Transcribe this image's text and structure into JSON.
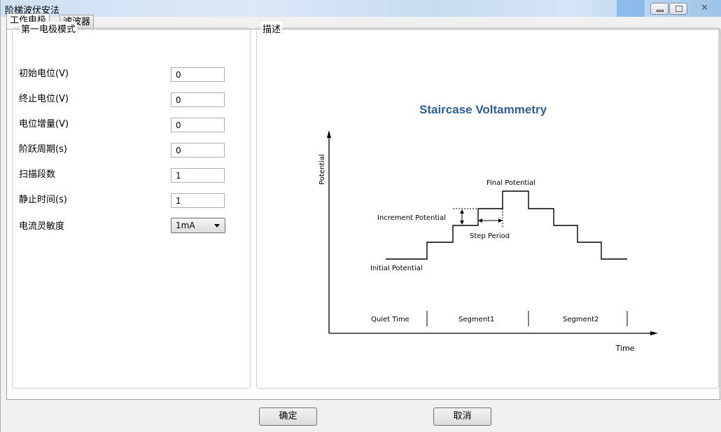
{
  "window": {
    "title": "阶梯波伏安法"
  },
  "tabs": [
    {
      "label": "工作电极",
      "active": true
    },
    {
      "label": "滤波器",
      "active": false
    }
  ],
  "left_group": {
    "title": "第一电极模式",
    "fields": [
      {
        "label": "初始电位(V)",
        "value": "0"
      },
      {
        "label": "终止电位(V)",
        "value": "0"
      },
      {
        "label": "电位增量(V)",
        "value": "0"
      },
      {
        "label": "阶跃周期(s)",
        "value": "0"
      },
      {
        "label": "扫描段数",
        "value": "1"
      },
      {
        "label": "静止时间(s)",
        "value": "1"
      }
    ],
    "sensitivity": {
      "label": "电流灵敏度",
      "selected": "1mA"
    }
  },
  "right_group": {
    "title": "描述",
    "diagram": {
      "title": "Staircase Voltammetry",
      "y_axis": "Potential",
      "x_axis": "Time",
      "final_potential": "Final Potential",
      "increment_potential": "Increment Potential",
      "step_period": "Step Period",
      "initial_potential": "Initial Potential",
      "quiet_time": "Quiet Time",
      "segment1": "Segment1",
      "segment2": "Segment2",
      "title_color": "#2e5f99"
    }
  },
  "buttons": {
    "ok": "确定",
    "cancel": "取消"
  }
}
